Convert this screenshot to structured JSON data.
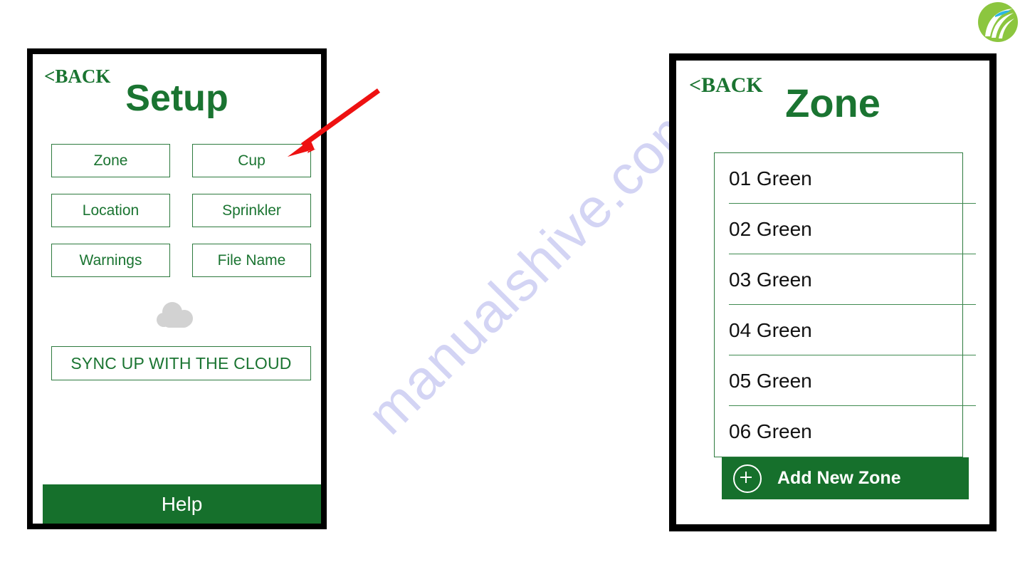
{
  "watermark": {
    "text": "manualshive.com"
  },
  "logo": {
    "name": "leaf-swoosh-logo",
    "circle_color": "#8cc63f",
    "swoosh_color": "#ffffff",
    "accent_color": "#29b6e8"
  },
  "annotation": {
    "arrow_color": "#ee1111",
    "points_to": "Cup"
  },
  "screens": [
    {
      "id": "setup",
      "back_label": "<BACK",
      "title": "Setup",
      "options": [
        {
          "label": "Zone"
        },
        {
          "label": "Cup"
        },
        {
          "label": "Location"
        },
        {
          "label": "Sprinkler"
        },
        {
          "label": "Warnings"
        },
        {
          "label": "File Name"
        }
      ],
      "cloud_icon": "cloud-icon",
      "sync_label": "SYNC UP WITH THE CLOUD",
      "help_label": "Help",
      "colors": {
        "green": "#1a7431",
        "border_green": "#2d7a3e",
        "help_bg": "#16702c",
        "cloud_gray": "#d2d2d2"
      }
    },
    {
      "id": "zone",
      "back_label": "<BACK",
      "title": "Zone",
      "zones": [
        {
          "label": "01 Green"
        },
        {
          "label": "02 Green"
        },
        {
          "label": "03 Green"
        },
        {
          "label": "04 Green"
        },
        {
          "label": "05 Green"
        },
        {
          "label": "06 Green"
        }
      ],
      "add_new_label": "Add New Zone",
      "add_new_icon": "plus-circle-icon",
      "colors": {
        "green": "#1a7431",
        "border_green": "#2d7a3e",
        "rule_green": "#3f8a50",
        "add_bar_bg": "#16702c",
        "zone_text": "#111111"
      }
    }
  ]
}
